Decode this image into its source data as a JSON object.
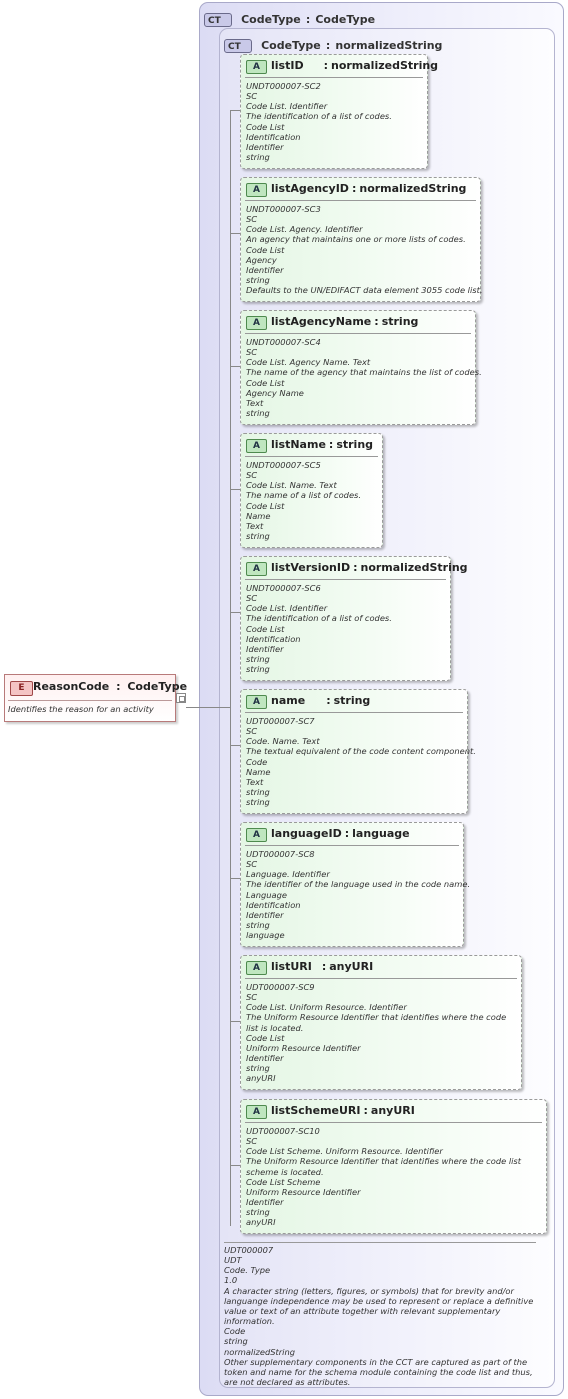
{
  "element": {
    "badge": "E",
    "name": "ReasonCode",
    "type": "CodeType",
    "documentation": "Identifies the reason for an activity"
  },
  "outer_type": {
    "badge": "CT",
    "name": "CodeType",
    "base": "CodeType"
  },
  "inner_type": {
    "badge": "CT",
    "name": "CodeType",
    "base": "normalizedString",
    "documentation": [
      "UDT000007",
      "UDT",
      "Code. Type",
      "1.0",
      "A character string (letters, figures, or symbols) that for brevity and/or languange independence may be used to represent or replace a definitive value or text of an attribute together with relevant supplementary information.",
      "Code",
      "string",
      "normalizedString",
      "Other supplementary components in the CCT are captured as part of the token and name for the schema module containing the code list and thus, are not declared as attributes."
    ]
  },
  "separator": ":",
  "attributes": [
    {
      "badge": "A",
      "name": "listID",
      "type": "normalizedString",
      "lines": [
        "UNDT000007-SC2",
        "SC",
        "Code List. Identifier",
        "The identification of a list of codes.",
        "Code List",
        "Identification",
        "Identifier",
        "string"
      ]
    },
    {
      "badge": "A",
      "name": "listAgencyID",
      "type": "normalizedString",
      "lines": [
        "UNDT000007-SC3",
        "SC",
        "Code List. Agency. Identifier",
        "An agency that maintains one or more lists of codes.",
        "Code List",
        "Agency",
        "Identifier",
        "string",
        "Defaults to the UN/EDIFACT data element 3055 code list."
      ]
    },
    {
      "badge": "A",
      "name": "listAgencyName",
      "type": "string",
      "lines": [
        "UNDT000007-SC4",
        "SC",
        "Code List. Agency Name. Text",
        "The name of the agency that maintains the list of codes.",
        "Code List",
        "Agency Name",
        "Text",
        "string"
      ]
    },
    {
      "badge": "A",
      "name": "listName",
      "type": "string",
      "lines": [
        "UNDT000007-SC5",
        "SC",
        "Code List. Name. Text",
        "The name of a list of codes.",
        "Code List",
        "Name",
        "Text",
        "string"
      ]
    },
    {
      "badge": "A",
      "name": "listVersionID",
      "type": "normalizedString",
      "lines": [
        "UNDT000007-SC6",
        "SC",
        "Code List. Identifier",
        "The identification of a list of codes.",
        "Code List",
        "Identification",
        "Identifier",
        "string",
        "string"
      ]
    },
    {
      "badge": "A",
      "name": "name",
      "type": "string",
      "lines": [
        "UDT000007-SC7",
        "SC",
        "Code. Name. Text",
        "The textual equivalent of the code content component.",
        "Code",
        "Name",
        "Text",
        "string",
        "string"
      ]
    },
    {
      "badge": "A",
      "name": "languageID",
      "type": "language",
      "lines": [
        "UDT000007-SC8",
        "SC",
        "Language. Identifier",
        "The identifier of the language used in the code name.",
        "Language",
        "Identification",
        "Identifier",
        "string",
        "language"
      ]
    },
    {
      "badge": "A",
      "name": "listURI",
      "type": "anyURI",
      "lines": [
        "UDT000007-SC9",
        "SC",
        "Code List. Uniform Resource. Identifier",
        "The Uniform Resource Identifier that identifies where the code list is located.",
        "Code List",
        "Uniform Resource Identifier",
        "Identifier",
        "string",
        "anyURI"
      ]
    },
    {
      "badge": "A",
      "name": "listSchemeURI",
      "type": "anyURI",
      "lines": [
        "UDT000007-SC10",
        "SC",
        "Code List Scheme. Uniform Resource. Identifier",
        "The Uniform Resource Identifier that identifies where the code list scheme is located.",
        "Code List Scheme",
        "Uniform Resource Identifier",
        "Identifier",
        "string",
        "anyURI"
      ]
    }
  ]
}
